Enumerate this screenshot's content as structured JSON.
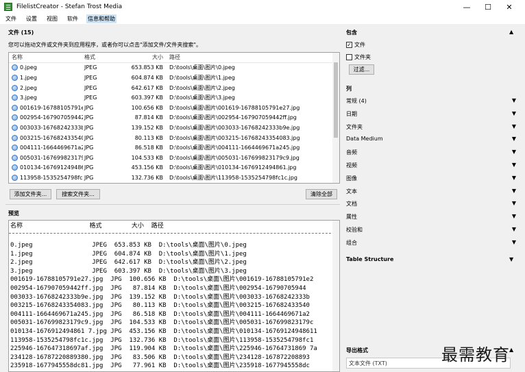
{
  "window": {
    "title": "FilelistCreator - Stefan Trost Media",
    "min_glyph": "—",
    "max_glyph": "☐",
    "close_glyph": "✕"
  },
  "menu": [
    "文件",
    "设置",
    "视图",
    "软件",
    "信息和帮助"
  ],
  "files_section": {
    "title": "文件 (15)",
    "hint": "您可以拖动文件或文件夹到应用程序，或者你可以点击\"添加文件/文件夹搜索\"。",
    "columns": [
      "名称",
      "格式",
      "大小",
      "路径"
    ],
    "rows": [
      {
        "name": "0.jpeg",
        "format": "JPEG",
        "size": "653.853 KB",
        "path": "D:\\tools\\桌面\\图片\\0.jpeg"
      },
      {
        "name": "1.jpeg",
        "format": "JPEG",
        "size": "604.874 KB",
        "path": "D:\\tools\\桌面\\图片\\1.jpeg"
      },
      {
        "name": "2.jpeg",
        "format": "JPEG",
        "size": "642.617 KB",
        "path": "D:\\tools\\桌面\\图片\\2.jpeg"
      },
      {
        "name": "3.jpeg",
        "format": "JPEG",
        "size": "603.397 KB",
        "path": "D:\\tools\\桌面\\图片\\3.jpeg"
      },
      {
        "name": "001619-16788105791e27.jpg",
        "format": "JPG",
        "size": "100.656 KB",
        "path": "D:\\tools\\桌面\\图片\\001619-16788105791e27.jpg"
      },
      {
        "name": "002954-167907059442ff.jpg",
        "format": "JPG",
        "size": "87.814 KB",
        "path": "D:\\tools\\桌面\\图片\\002954-167907059442ff.jpg"
      },
      {
        "name": "003033-16768242333b9e.jpg",
        "format": "JPG",
        "size": "139.152 KB",
        "path": "D:\\tools\\桌面\\图片\\003033-16768242333b9e.jpg"
      },
      {
        "name": "003215-16768243354083.jpg",
        "format": "JPG",
        "size": "80.113 KB",
        "path": "D:\\tools\\桌面\\图片\\003215-16768243354083.jpg"
      },
      {
        "name": "004111-1664469671a245.jpg",
        "format": "JPG",
        "size": "86.518 KB",
        "path": "D:\\tools\\桌面\\图片\\004111-1664469671a245.jpg"
      },
      {
        "name": "005031-167699823179c9.jpg",
        "format": "JPG",
        "size": "104.533 KB",
        "path": "D:\\tools\\桌面\\图片\\005031-167699823179c9.jpg"
      },
      {
        "name": "010134-1676912494861.jpg",
        "format": "JPG",
        "size": "453.156 KB",
        "path": "D:\\tools\\桌面\\图片\\010134-1676912494861.jpg"
      },
      {
        "name": "113958-1535254798fc1c.jpg",
        "format": "JPG",
        "size": "132.736 KB",
        "path": "D:\\tools\\桌面\\图片\\113958-1535254798fc1c.jpg"
      }
    ],
    "add_folder_label": "添加文件夹...",
    "search_folder_label": "搜索文件夹...",
    "clear_all_label": "清除全部"
  },
  "preview": {
    "title": "预览",
    "header": "名称                  格式        大小  路径",
    "lines": [
      "0.jpeg                JPEG  653.853 KB  D:\\tools\\桌面\\图片\\0.jpeg",
      "1.jpeg                JPEG  604.874 KB  D:\\tools\\桌面\\图片\\1.jpeg",
      "2.jpeg                JPEG  642.617 KB  D:\\tools\\桌面\\图片\\2.jpeg",
      "3.jpeg                JPEG  603.397 KB  D:\\tools\\桌面\\图片\\3.jpeg",
      "001619-16788105791e27.jpg  JPG  100.656 KB  D:\\tools\\桌面\\图片\\001619-16788105791e2",
      "002954-167907059442ff.jpg  JPG   87.814 KB  D:\\tools\\桌面\\图片\\002954-16790705944",
      "003033-16768242333b9e.jpg  JPG  139.152 KB  D:\\tools\\桌面\\图片\\003033-16768242333b",
      "003215-16768243354083.jpg  JPG   80.113 KB  D:\\tools\\桌面\\图片\\003215-167682433540",
      "004111-1664469671a245.jpg  JPG   86.518 KB  D:\\tools\\桌面\\图片\\004111-1664469671a2",
      "005031-167699823179c9.jpg  JPG  104.533 KB  D:\\tools\\桌面\\图片\\005031-167699823179c",
      "010134-1676912494861 7.jpg JPG  453.156 KB  D:\\tools\\桌面\\图片\\010134-16769124948611",
      "113958-1535254798fc1c.jpg  JPG  132.736 KB  D:\\tools\\桌面\\图片\\113958-1535254798fc1",
      "225946-167647318697af.jpg  JPG  119.904 KB  D:\\tools\\桌面\\图片\\225946-16764731869 7a",
      "234128-16787220889380.jpg  JPG   83.506 KB  D:\\tools\\桌面\\图片\\234128-167872208893",
      "235918-1677945558dc81.jpg  JPG   77.961 KB  D:\\tools\\桌面\\图片\\235918-1677945558dc"
    ]
  },
  "right_panel": {
    "include_title": "包含",
    "include_files_label": "文件",
    "include_folders_label": "文件夹",
    "filter_label": "过滤...",
    "columns_title": "列",
    "column_groups": [
      "常规 (4)",
      "日期",
      "文件夹",
      "Data Medium",
      "音频",
      "视频",
      "图像",
      "文本",
      "文档",
      "属性",
      "校验和",
      "组合"
    ],
    "table_structure_label": "Table Structure",
    "export_title": "导出格式",
    "export_value": "文本文件 (TXT)"
  },
  "watermark": "最需教育"
}
